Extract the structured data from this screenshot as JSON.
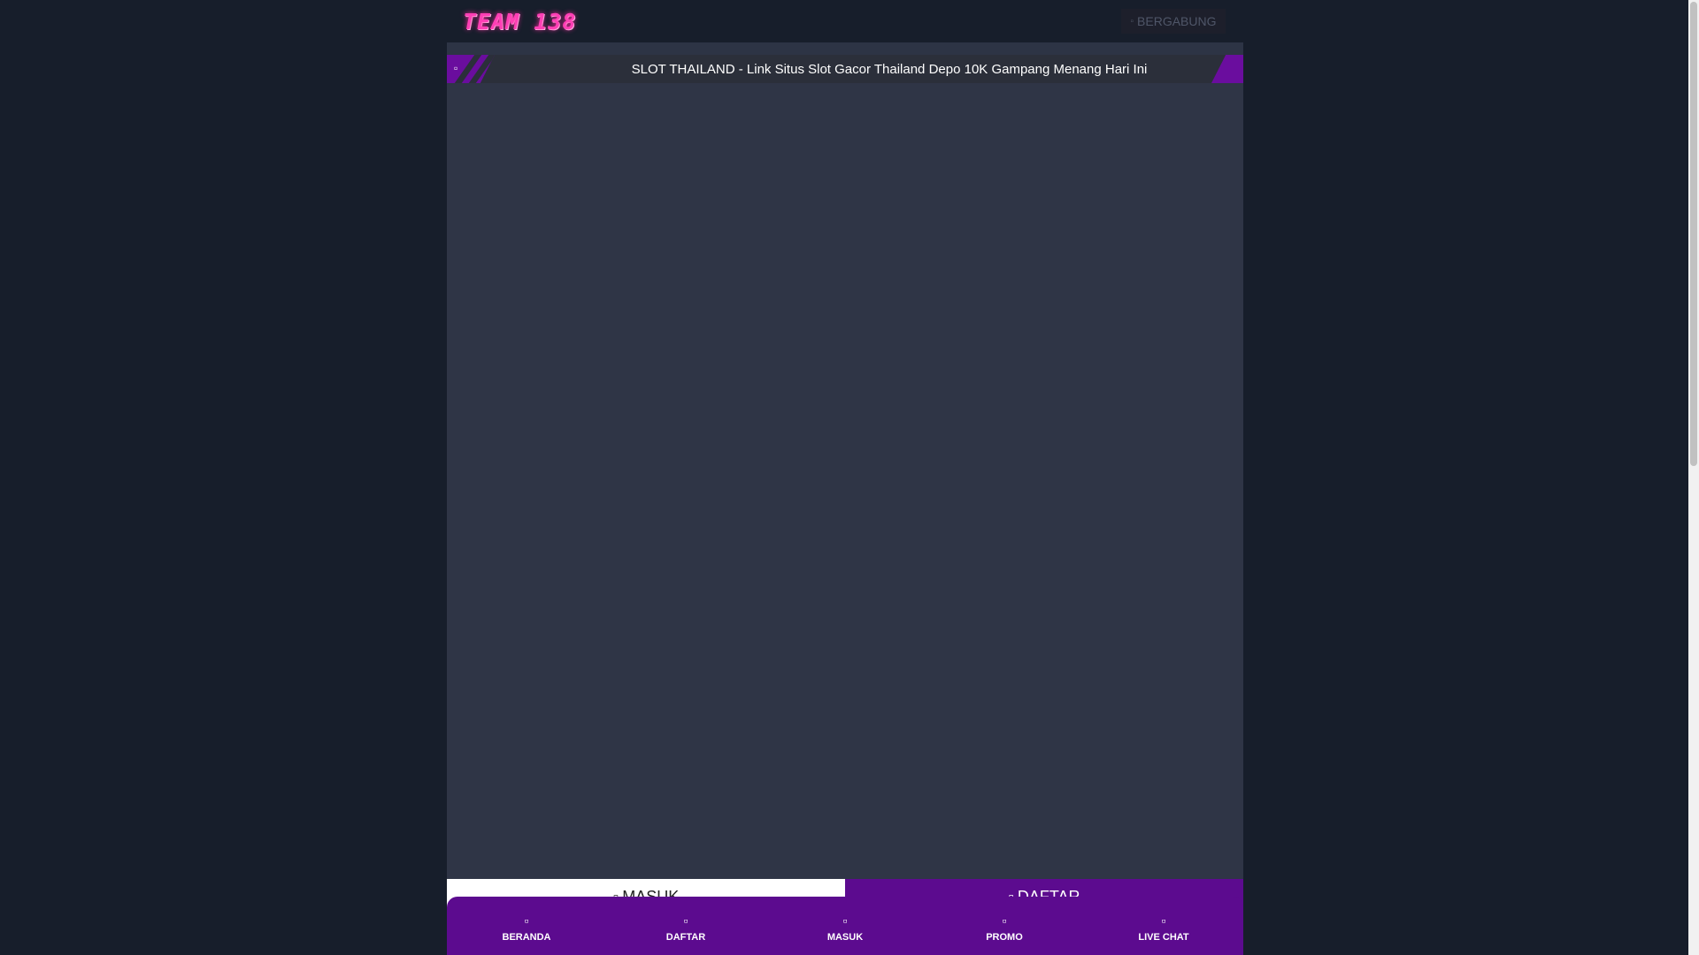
{
  "header": {
    "logo_text": "TEAM 138",
    "join_label": "BERGABUNG"
  },
  "marquee": {
    "text": "SLOT THAILAND - Link Situs Slot Gacor Thailand Depo 10K Gampang Menang Hari Ini"
  },
  "auth": {
    "login_label": "MASUK",
    "register_label": "DAFTAR"
  },
  "bottom_nav": {
    "items": [
      {
        "label": "BERANDA",
        "icon": "home-icon"
      },
      {
        "label": "DAFTAR",
        "icon": "register-icon"
      },
      {
        "label": "MASUK",
        "icon": "login-icon"
      },
      {
        "label": "PROMO",
        "icon": "gift-icon"
      },
      {
        "label": "LIVE CHAT",
        "icon": "chat-icon"
      }
    ]
  },
  "colors": {
    "page_bg": "#171e2b",
    "panel_bg": "#2f3546",
    "accent_purple": "#5c0b8f",
    "logo_pink": "#ff3fb5"
  }
}
